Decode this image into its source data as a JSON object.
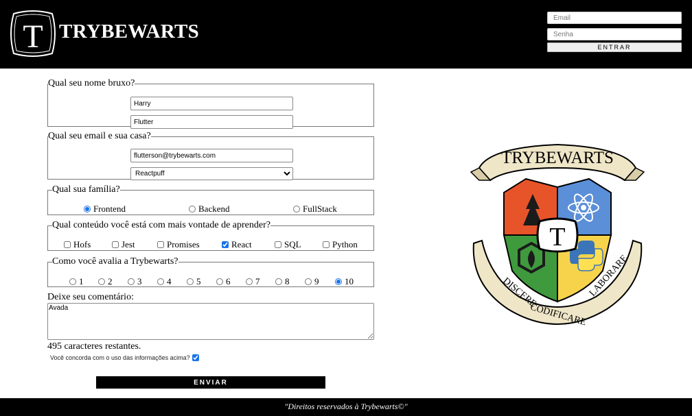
{
  "header": {
    "brand": "TRYBEWARTS",
    "logo_letter": "T",
    "login": {
      "email_placeholder": "Email",
      "password_placeholder": "Senha",
      "submit_label": "ENTRAR"
    }
  },
  "form": {
    "name": {
      "legend": "Qual seu nome bruxo?",
      "first_name": "Harry",
      "last_name": "Flutter"
    },
    "email_house": {
      "legend": "Qual seu email e sua casa?",
      "email": "flutterson@trybewarts.com",
      "house": "Reactpuff"
    },
    "family": {
      "legend": "Qual sua família?",
      "options": [
        "Frontend",
        "Backend",
        "FullStack"
      ],
      "selected": "Frontend"
    },
    "content": {
      "legend": "Qual conteúdo você está com mais vontade de aprender?",
      "options": [
        "Hofs",
        "Jest",
        "Promises",
        "React",
        "SQL",
        "Python"
      ],
      "checked": [
        "React"
      ]
    },
    "rating": {
      "legend": "Como você avalia a Trybewarts?",
      "options": [
        "1",
        "2",
        "3",
        "4",
        "5",
        "6",
        "7",
        "8",
        "9",
        "10"
      ],
      "selected": "10"
    },
    "comment": {
      "label": "Deixe seu comentário:",
      "value": "Avada",
      "remaining": "495 caracteres restantes."
    },
    "agreement": {
      "label": "Você concorda com o uso das informações acima?",
      "checked": true
    },
    "submit_label": "ENVIAR"
  },
  "crest": {
    "banner": "TRYBEWARTS",
    "center_letter": "T",
    "motto": [
      "DISCERE",
      "CODIFICARE",
      "LABORARE"
    ]
  },
  "footer": {
    "text": "\"Direitos reservados à Trybewarts©\""
  }
}
